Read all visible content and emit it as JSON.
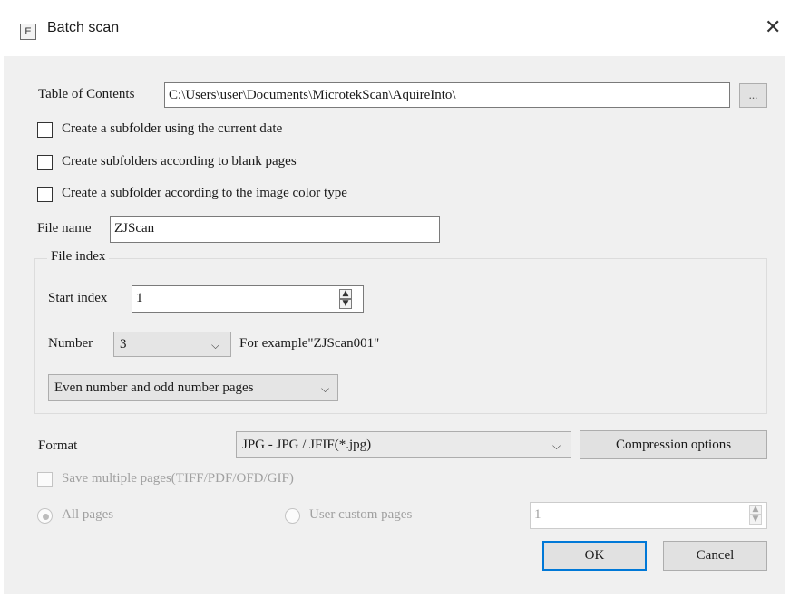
{
  "window": {
    "title": "Batch scan",
    "icon": "app-icon",
    "icon_glyph": "E",
    "close_glyph": "✕"
  },
  "toc": {
    "label": "Table of Contents",
    "path": "C:\\Users\\user\\Documents\\MicrotekScan\\AquireInto\\",
    "browse_label": "..."
  },
  "options": {
    "subfolder_date": {
      "label": "Create a subfolder using the current date",
      "checked": false
    },
    "subfolder_blank": {
      "label": "Create subfolders according to blank pages",
      "checked": false
    },
    "subfolder_color": {
      "label": "Create a subfolder according to the image color type",
      "checked": false
    }
  },
  "file_name": {
    "label": "File name",
    "value": "ZJScan"
  },
  "file_index": {
    "group_label": "File index",
    "start_index_label": "Start index",
    "start_index_value": "1",
    "number_label": "Number",
    "number_value": "3",
    "example_text": "For example\"ZJScan001\"",
    "pages_mode": "Even number and odd number pages"
  },
  "format": {
    "label": "Format",
    "value": "JPG - JPG / JFIF(*.jpg)",
    "compression_label": "Compression options"
  },
  "multi_page": {
    "label": "Save multiple pages(TIFF/PDF/OFD/GIF)",
    "enabled": false
  },
  "pages": {
    "all_label": "All pages",
    "custom_label": "User custom pages",
    "custom_value": "1",
    "selected": "all"
  },
  "buttons": {
    "ok": "OK",
    "cancel": "Cancel"
  }
}
